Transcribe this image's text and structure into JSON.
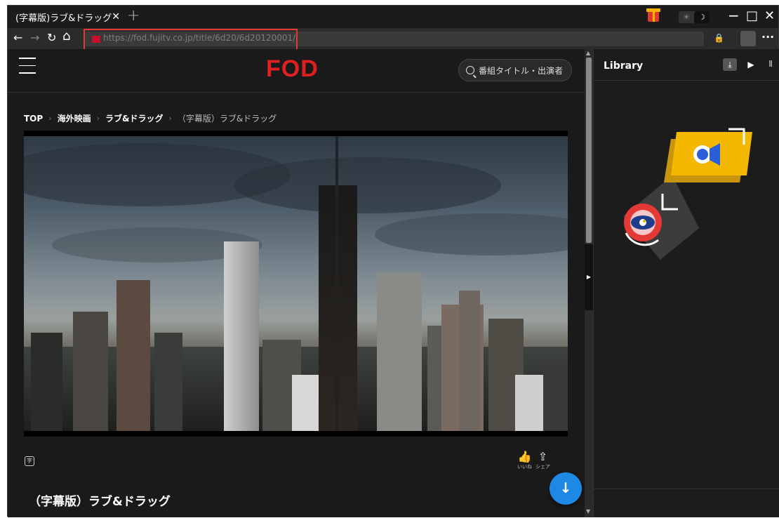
{
  "tab": {
    "title": "(字幕版)ラブ&ドラッグ",
    "close": "✕",
    "new_tab": "+"
  },
  "window_controls": {
    "minimize": "−",
    "maximize": "□",
    "close": "✕"
  },
  "theme": {
    "sun": "☀",
    "moon": "☽"
  },
  "nav": {
    "back": "←",
    "forward": "→",
    "reload": "↻",
    "home": "⌂",
    "url": "https://fod.fujitv.co.jp/title/6d20/6d20120001/",
    "lock": "🔒",
    "more": "···"
  },
  "site": {
    "logo": "FOD",
    "search_placeholder": "番組タイトル・出演者",
    "breadcrumb": [
      "TOP",
      "海外映画",
      "ラブ&ドラッグ",
      "（字幕版）ラブ&ドラッグ"
    ],
    "subtitle_badge": "字",
    "actions": [
      {
        "glyph": "👍",
        "label": "いいね"
      },
      {
        "glyph": "⇪",
        "label": "シェア"
      }
    ],
    "title": "（字幕版）ラブ&ドラッグ",
    "download": "↓"
  },
  "library": {
    "title": "Library",
    "tabs": [
      "⤓",
      "▶",
      "⫼"
    ]
  },
  "colors": {
    "accent": "#1e88e5",
    "brand": "#e02020",
    "highlight": "#e53935"
  }
}
